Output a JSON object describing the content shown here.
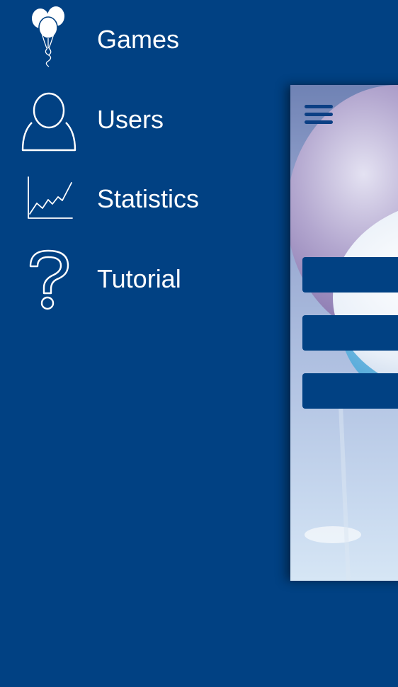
{
  "colors": {
    "background": "#014183",
    "menu_text": "#ffffff",
    "panel_button": "#014183",
    "hamburger": "#0b3f84"
  },
  "drawer": {
    "items": [
      {
        "label": "Games",
        "icon": "balloons-icon"
      },
      {
        "label": "Users",
        "icon": "user-icon"
      },
      {
        "label": "Statistics",
        "icon": "line-chart-icon"
      },
      {
        "label": "Tutorial",
        "icon": "question-mark-icon"
      }
    ]
  },
  "main_panel": {
    "menu_icon": "hamburger-menu-icon",
    "background_image": "balloons-sky-image",
    "buttons": [
      {
        "label": ""
      },
      {
        "label": ""
      },
      {
        "label": ""
      }
    ]
  }
}
